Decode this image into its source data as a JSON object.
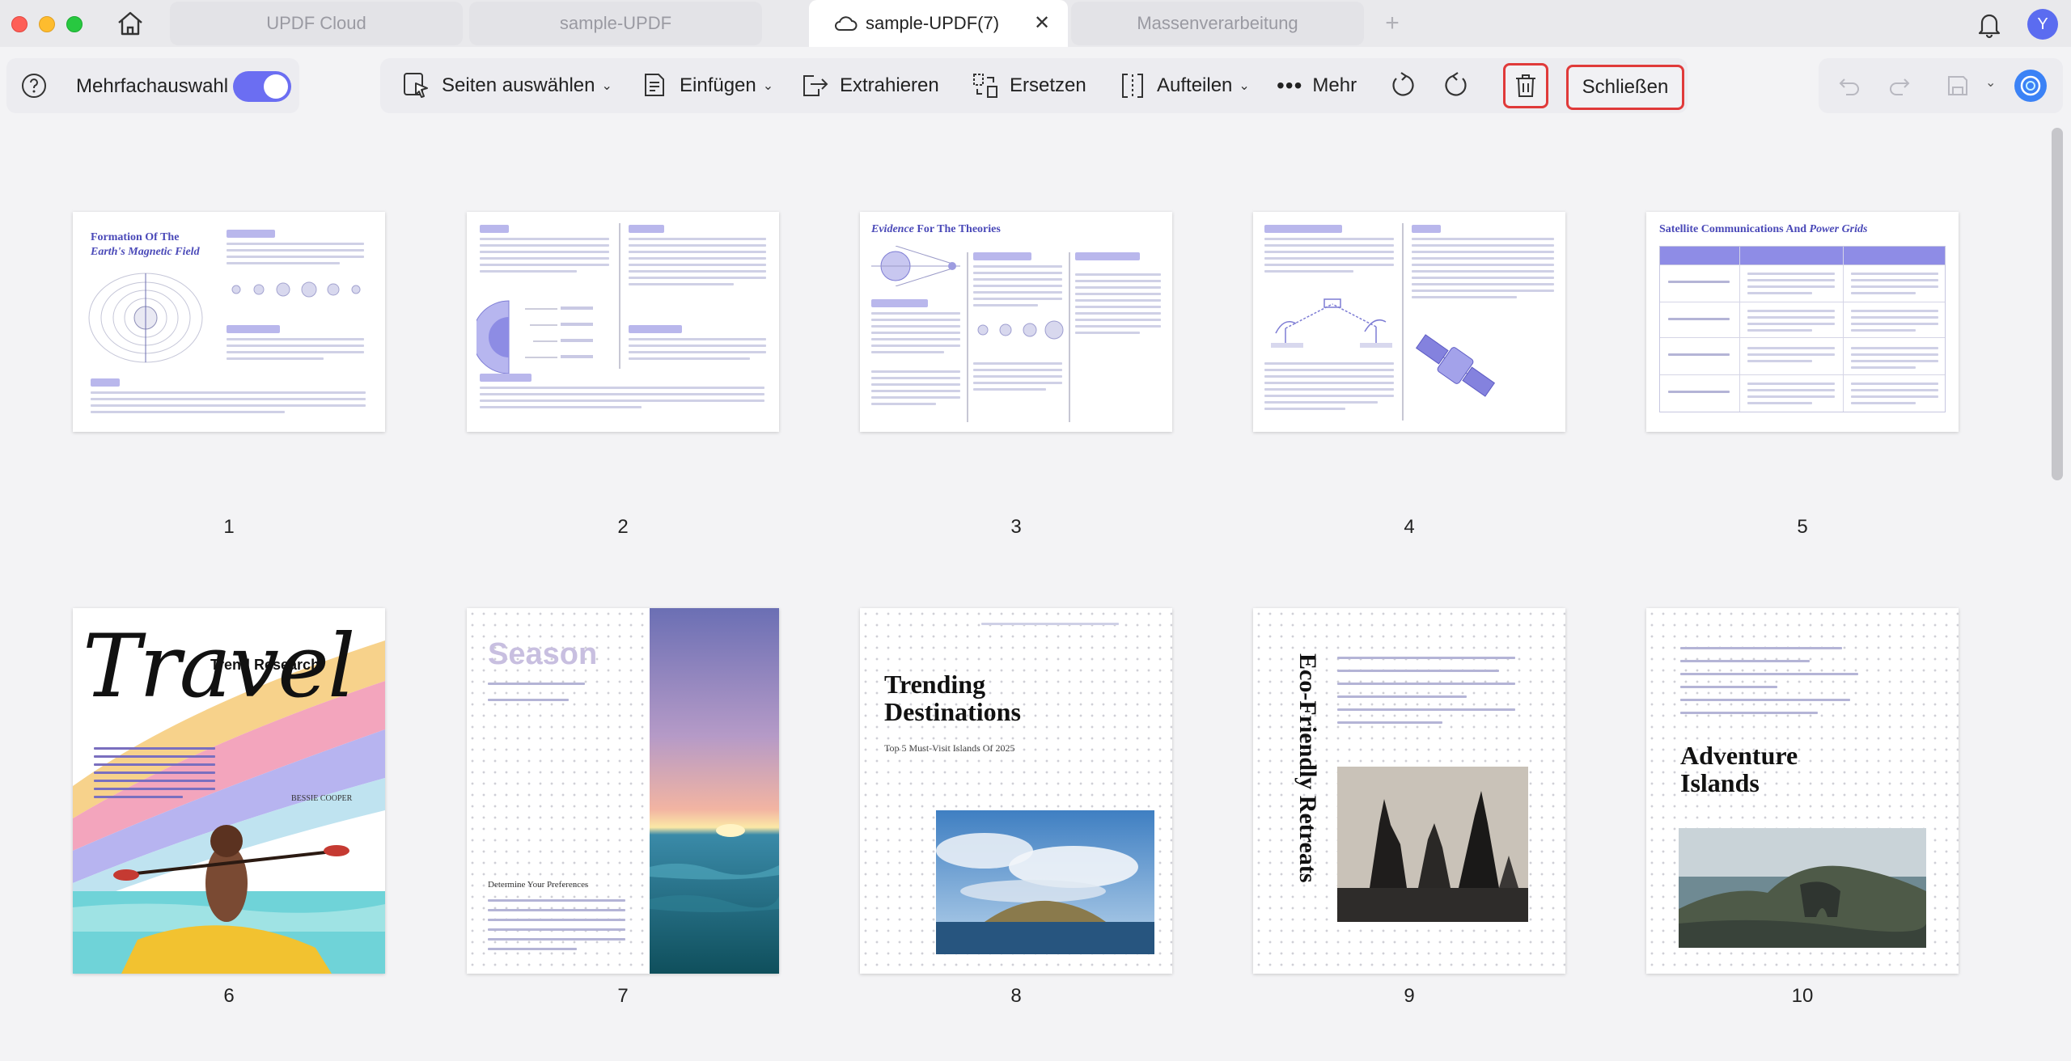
{
  "tabs": [
    {
      "label": "UPDF Cloud"
    },
    {
      "label": "sample-UPDF"
    },
    {
      "label": "sample-UPDF(7)"
    },
    {
      "label": "Massenverarbeitung"
    }
  ],
  "user": {
    "initial": "Y"
  },
  "toolbar": {
    "multi_select_label": "Mehrfachauswahl",
    "select_pages": "Seiten auswählen",
    "insert": "Einfügen",
    "extract": "Extrahieren",
    "replace": "Ersetzen",
    "split": "Aufteilen",
    "more": "Mehr",
    "close": "Schließen"
  },
  "colors": {
    "accent": "#6b6ef2",
    "highlight": "#e03a3a"
  },
  "pages": [
    {
      "number": "1",
      "title_line1": "Formation Of The",
      "title_line2": "Earth's Magnetic Field"
    },
    {
      "number": "2"
    },
    {
      "number": "3",
      "title_italic": "Evidence",
      "title_rest": " For The Theories"
    },
    {
      "number": "4"
    },
    {
      "number": "5",
      "title": "Satellite Communications And ",
      "title_italic": "Power Grids"
    },
    {
      "number": "6",
      "big": "Travel",
      "sub": "Trend Research",
      "author": "BESSIE COOPER"
    },
    {
      "number": "7",
      "heading": "Season",
      "sub": "Determine Your Preferences"
    },
    {
      "number": "8",
      "heading_line1": "Trending",
      "heading_line2": "Destinations",
      "sub": "Top 5 Must-Visit Islands Of 2025"
    },
    {
      "number": "9",
      "vertical": "Eco-Friendly Retreats"
    },
    {
      "number": "10",
      "heading_line1": "Adventure",
      "heading_line2": "Islands"
    }
  ]
}
